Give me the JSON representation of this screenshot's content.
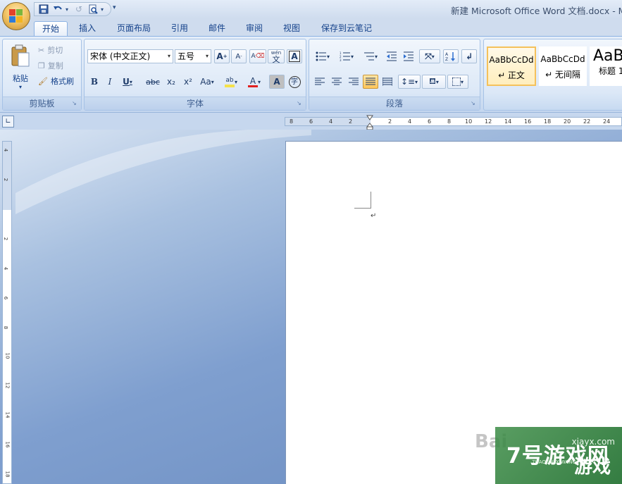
{
  "window": {
    "title": "新建 Microsoft Office Word 文档.docx - M"
  },
  "quick_access": {
    "icons": [
      "save-icon",
      "undo-icon",
      "redo-icon",
      "print-preview-icon",
      "customize-icon"
    ]
  },
  "tabs": [
    {
      "label": "开始",
      "active": true
    },
    {
      "label": "插入"
    },
    {
      "label": "页面布局"
    },
    {
      "label": "引用"
    },
    {
      "label": "邮件"
    },
    {
      "label": "审阅"
    },
    {
      "label": "视图"
    },
    {
      "label": "保存到云笔记"
    }
  ],
  "clipboard": {
    "group_label": "剪贴板",
    "paste_label": "粘贴",
    "cut_label": "剪切",
    "copy_label": "复制",
    "format_painter_label": "格式刷"
  },
  "font": {
    "group_label": "字体",
    "font_name": "宋体 (中文正文)",
    "font_size": "五号",
    "bold": "B",
    "italic": "I",
    "underline": "U",
    "strikethrough": "abc",
    "subscript": "x₂",
    "superscript": "x²",
    "change_case": "Aa",
    "grow": "A",
    "shrink": "A",
    "clear_format": "A",
    "text_highlight": "ab",
    "font_color": "A",
    "char_shading": "A",
    "enclose": "字",
    "phonetic": "wén",
    "phonetic_char": "文",
    "border_char": "A",
    "highlight_color": "#f5e14a",
    "font_color_value": "#e02020"
  },
  "paragraph": {
    "group_label": "段落"
  },
  "styles": {
    "items": [
      {
        "sample": "AaBbCcDd",
        "name": "↵ 正文",
        "active": true
      },
      {
        "sample": "AaBbCcDd",
        "name": "↵ 无间隔"
      },
      {
        "sample": "AaB",
        "name": "标题 1"
      }
    ]
  },
  "ruler": {
    "left_ticks": [
      "8",
      "6",
      "4",
      "2"
    ],
    "right_ticks": [
      "2",
      "4",
      "6",
      "8",
      "10",
      "12",
      "14",
      "16",
      "18",
      "20",
      "22",
      "24"
    ],
    "vertical_ticks": [
      "4",
      "2",
      "2",
      "4",
      "6",
      "8",
      "10",
      "12",
      "14",
      "16",
      "18"
    ]
  },
  "document": {
    "paragraph_mark": "↵"
  },
  "watermark": {
    "site": "xiayx.com",
    "main": "7号游戏网",
    "sub": "7HAOYOUXIWANG",
    "big": "游戏",
    "baidu": "Bai"
  }
}
